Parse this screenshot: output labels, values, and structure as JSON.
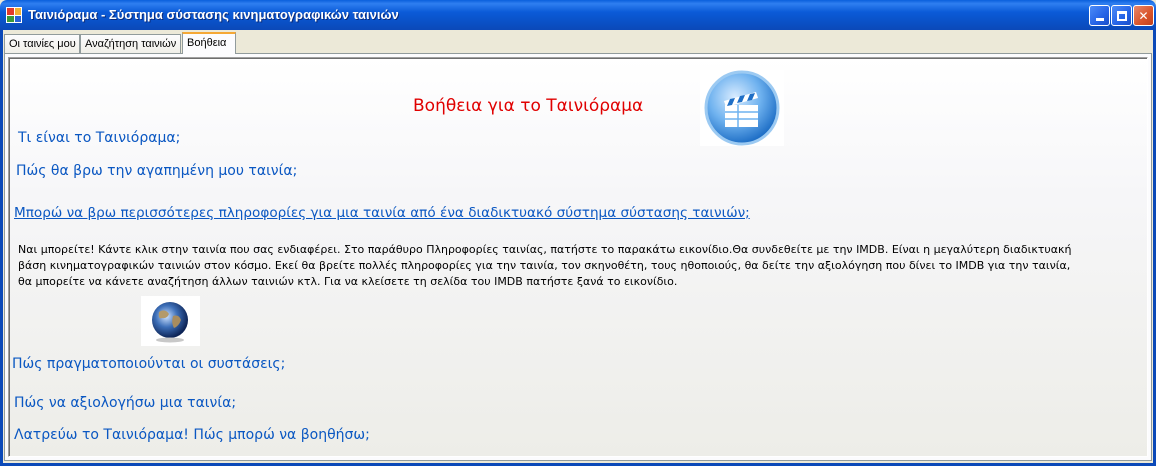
{
  "window": {
    "title": "Ταινιόραμα - Σύστημα σύστασης κινηματογραφικών ταινιών",
    "controls": [
      "minimize",
      "maximize",
      "close"
    ]
  },
  "tabs": [
    {
      "label": "Οι ταινίες μου",
      "active": false
    },
    {
      "label": "Αναζήτηση ταινιών",
      "active": false
    },
    {
      "label": "Βοήθεια",
      "active": true
    }
  ],
  "help": {
    "title": "Βοήθεια για το Ταινιόραμα",
    "q1": "Τι είναι το Ταινιόραμα;",
    "q2": "Πώς θα βρω την αγαπημένη μου ταινία;",
    "q3": "Μπορώ να βρω περισσότερες πληροφορίες για μια ταινία από ένα διαδικτυακό σύστημα σύστασης ταινιών;",
    "answer": "Ναι μπορείτε! Κάντε κλικ στην ταινία που σας ενδιαφέρει. Στο παράθυρο Πληροφορίες ταινίας, πατήστε το παρακάτω εικονίδιο.Θα συνδεθείτε με την IMDB. Είναι η μεγαλύτερη διαδικτυακή βάση κινηματογραφικών ταινιών στον κόσμο. Εκεί θα βρείτε πολλές πληροφορίες για την ταινία, τον σκηνοθέτη, τους ηθοποιούς,  θα δείτε την αξιολόγηση που δίνει το IMDB για την ταινία, θα μπορείτε να κάνετε αναζήτηση άλλων ταινιών κτλ. Για να κλείσετε τη σελίδα του IMDB πατήστε ξανά το εικονίδιο.",
    "q4": "Πώς πραγματοποιούνται οι συστάσεις;",
    "q5": "Πώς να αξιολογήσω μια ταινία;",
    "q6": "Λατρεύω το Ταινιόραμα! Πώς μπορώ να βοηθήσω;"
  },
  "icons": {
    "app": "app-icon",
    "clapper": "clapperboard-icon",
    "globe": "globe-icon"
  },
  "colors": {
    "title_bar": "#0b5bd8",
    "help_title": "#e00000",
    "question": "#0a57c2",
    "active_tab_accent": "#f5a835"
  }
}
